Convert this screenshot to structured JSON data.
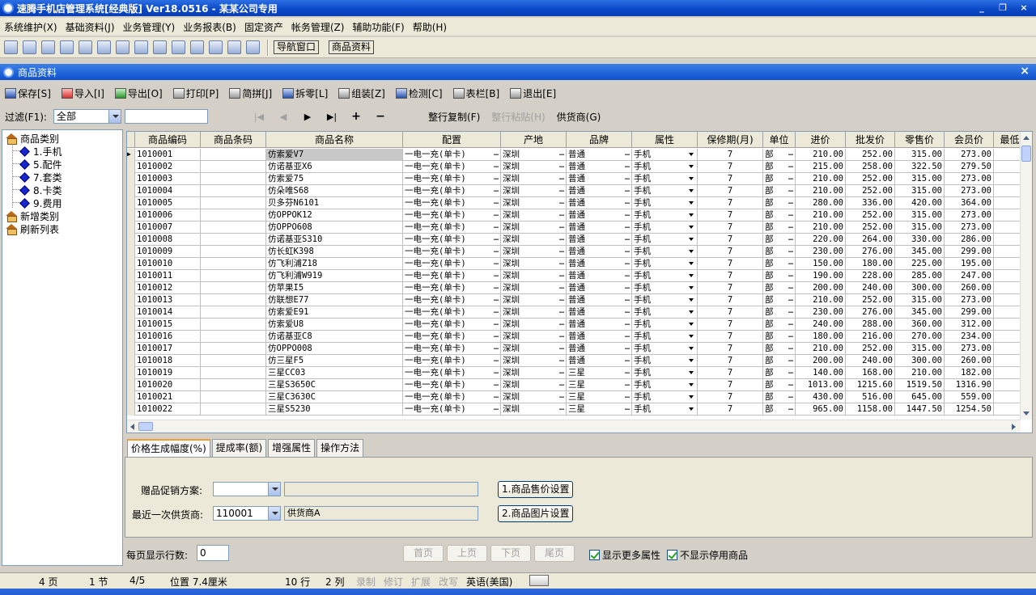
{
  "window": {
    "title": "速腾手机店管理系统[经典版] Ver18.0516 - 某某公司专用",
    "min": "_",
    "max": "❐",
    "close": "×"
  },
  "menu": [
    "系统维护(X)",
    "基础资料(J)",
    "业务管理(Y)",
    "业务报表(B)",
    "固定资产",
    "帐务管理(Z)",
    "辅助功能(F)",
    "帮助(H)"
  ],
  "main_toolbar": {
    "nav_window": "导航窗口",
    "product_info": "商品资料"
  },
  "subwindow": {
    "title": "商品资料",
    "close": "×"
  },
  "toolbar": {
    "save": "保存[S]",
    "import": "导入[I]",
    "export": "导出[O]",
    "print": "打印[P]",
    "simple": "简拼[J]",
    "split": "拆零[L]",
    "assemble": "组装[Z]",
    "check": "检测[C]",
    "columns": "表栏[B]",
    "exit": "退出[E]"
  },
  "filter": {
    "label": "过滤(F1):",
    "value": "全部",
    "copy_row": "整行复制(F)",
    "paste_row": "整行粘贴(H)",
    "supplier": "供货商(G)"
  },
  "tree": {
    "root": "商品类别",
    "children": [
      "1.手机",
      "5.配件",
      "7.套类",
      "8.卡类",
      "9.费用"
    ],
    "add": "新增类别",
    "refresh": "刷新列表"
  },
  "table": {
    "columns": [
      "商品编码",
      "商品条码",
      "商品名称",
      "配置",
      "产地",
      "品牌",
      "属性",
      "保修期(月)",
      "单位",
      "进价",
      "批发价",
      "零售价",
      "会员价",
      "最低"
    ],
    "rows": [
      [
        "1010001",
        "",
        "仿索爱V7",
        "一电一充(单卡)",
        "深圳",
        "普通",
        "手机",
        "7",
        "部",
        "210.00",
        "252.00",
        "315.00",
        "273.00"
      ],
      [
        "1010002",
        "",
        "仿诺基亚X6",
        "一电一充(单卡)",
        "深圳",
        "普通",
        "手机",
        "7",
        "部",
        "215.00",
        "258.00",
        "322.50",
        "279.50"
      ],
      [
        "1010003",
        "",
        "仿索爱75",
        "一电一充(单卡)",
        "深圳",
        "普通",
        "手机",
        "7",
        "部",
        "210.00",
        "252.00",
        "315.00",
        "273.00"
      ],
      [
        "1010004",
        "",
        "仿朵唯S68",
        "一电一充(单卡)",
        "深圳",
        "普通",
        "手机",
        "7",
        "部",
        "210.00",
        "252.00",
        "315.00",
        "273.00"
      ],
      [
        "1010005",
        "",
        "贝多芬N6101",
        "一电一充(单卡)",
        "深圳",
        "普通",
        "手机",
        "7",
        "部",
        "280.00",
        "336.00",
        "420.00",
        "364.00"
      ],
      [
        "1010006",
        "",
        "仿OPPOK12",
        "一电一充(单卡)",
        "深圳",
        "普通",
        "手机",
        "7",
        "部",
        "210.00",
        "252.00",
        "315.00",
        "273.00"
      ],
      [
        "1010007",
        "",
        "仿OPPO608",
        "一电一充(单卡)",
        "深圳",
        "普通",
        "手机",
        "7",
        "部",
        "210.00",
        "252.00",
        "315.00",
        "273.00"
      ],
      [
        "1010008",
        "",
        "仿诺基亚S310",
        "一电一充(单卡)",
        "深圳",
        "普通",
        "手机",
        "7",
        "部",
        "220.00",
        "264.00",
        "330.00",
        "286.00"
      ],
      [
        "1010009",
        "",
        "仿长虹K398",
        "一电一充(单卡)",
        "深圳",
        "普通",
        "手机",
        "7",
        "部",
        "230.00",
        "276.00",
        "345.00",
        "299.00"
      ],
      [
        "1010010",
        "",
        "仿飞利浦Z18",
        "一电一充(单卡)",
        "深圳",
        "普通",
        "手机",
        "7",
        "部",
        "150.00",
        "180.00",
        "225.00",
        "195.00"
      ],
      [
        "1010011",
        "",
        "仿飞利浦W919",
        "一电一充(单卡)",
        "深圳",
        "普通",
        "手机",
        "7",
        "部",
        "190.00",
        "228.00",
        "285.00",
        "247.00"
      ],
      [
        "1010012",
        "",
        "仿苹果I5",
        "一电一充(单卡)",
        "深圳",
        "普通",
        "手机",
        "7",
        "部",
        "200.00",
        "240.00",
        "300.00",
        "260.00"
      ],
      [
        "1010013",
        "",
        "仿联想E77",
        "一电一充(单卡)",
        "深圳",
        "普通",
        "手机",
        "7",
        "部",
        "210.00",
        "252.00",
        "315.00",
        "273.00"
      ],
      [
        "1010014",
        "",
        "仿索爱E91",
        "一电一充(单卡)",
        "深圳",
        "普通",
        "手机",
        "7",
        "部",
        "230.00",
        "276.00",
        "345.00",
        "299.00"
      ],
      [
        "1010015",
        "",
        "仿索爱U8",
        "一电一充(单卡)",
        "深圳",
        "普通",
        "手机",
        "7",
        "部",
        "240.00",
        "288.00",
        "360.00",
        "312.00"
      ],
      [
        "1010016",
        "",
        "仿诺基亚C8",
        "一电一充(单卡)",
        "深圳",
        "普通",
        "手机",
        "7",
        "部",
        "180.00",
        "216.00",
        "270.00",
        "234.00"
      ],
      [
        "1010017",
        "",
        "仿OPPO008",
        "一电一充(单卡)",
        "深圳",
        "普通",
        "手机",
        "7",
        "部",
        "210.00",
        "252.00",
        "315.00",
        "273.00"
      ],
      [
        "1010018",
        "",
        "仿三星F5",
        "一电一充(单卡)",
        "深圳",
        "普通",
        "手机",
        "7",
        "部",
        "200.00",
        "240.00",
        "300.00",
        "260.00"
      ],
      [
        "1010019",
        "",
        "三星CC03",
        "一电一充(单卡)",
        "深圳",
        "三星",
        "手机",
        "7",
        "部",
        "140.00",
        "168.00",
        "210.00",
        "182.00"
      ],
      [
        "1010020",
        "",
        "三星S3650C",
        "一电一充(单卡)",
        "深圳",
        "三星",
        "手机",
        "7",
        "部",
        "1013.00",
        "1215.60",
        "1519.50",
        "1316.90"
      ],
      [
        "1010021",
        "",
        "三星C3630C",
        "一电一充(单卡)",
        "深圳",
        "三星",
        "手机",
        "7",
        "部",
        "430.00",
        "516.00",
        "645.00",
        "559.00"
      ],
      [
        "1010022",
        "",
        "三星S5230",
        "一电一充(单卡)",
        "深圳",
        "三星",
        "手机",
        "7",
        "部",
        "965.00",
        "1158.00",
        "1447.50",
        "1254.50"
      ]
    ]
  },
  "tabs": [
    "价格生成幅度(%)",
    "提成率(额)",
    "增强属性",
    "操作方法"
  ],
  "panel": {
    "gift_label": "赠品促销方案:",
    "gift_value": "",
    "gift_desc": "",
    "supplier_label": "最近一次供货商:",
    "supplier_code": "110001",
    "supplier_name": "供货商A",
    "price_btn": "1.商品售价设置",
    "image_btn": "2.商品图片设置"
  },
  "pager": {
    "rows_label": "每页显示行数:",
    "rows_value": "0",
    "first": "首页",
    "prev": "上页",
    "next": "下页",
    "last": "尾页",
    "show_more": "显示更多属性",
    "hide_disabled": "不显示停用商品"
  },
  "statusbar": {
    "page": "4 页",
    "section": "1 节",
    "count": "4/5",
    "position": "位置 7.4厘米",
    "row": "10 行",
    "col": "2 列",
    "rec": "录制",
    "rev": "修订",
    "ext": "扩展",
    "ovr": "改写",
    "lang": "英语(美国)"
  }
}
